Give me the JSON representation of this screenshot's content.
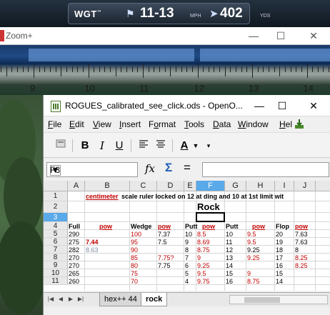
{
  "hud": {
    "logo": "WGT",
    "logo_mark": "™",
    "wind": "11-13",
    "wind_unit": "MPH",
    "distance": "402",
    "distance_unit": "YDS"
  },
  "zoom": {
    "title": "Zoom+",
    "minimize": "—",
    "maximize": "☐",
    "close": "✕",
    "ruler_numbers": [
      "9",
      "10",
      "11",
      "12",
      "13",
      "14"
    ]
  },
  "calc": {
    "title": "ROGUES_calibrated_see_click.ods - OpenO...",
    "minimize": "—",
    "maximize": "☐",
    "close": "✕",
    "menus": [
      {
        "label": "File",
        "u": "F",
        "rest": "ile"
      },
      {
        "label": "Edit",
        "u": "E",
        "rest": "dit"
      },
      {
        "label": "View",
        "u": "V",
        "rest": "iew"
      },
      {
        "label": "Insert",
        "u": "I",
        "rest": "nsert"
      },
      {
        "label": "Format",
        "u": "o",
        "pre": "F",
        "rest": "rmat"
      },
      {
        "label": "Tools",
        "u": "T",
        "rest": "ools"
      },
      {
        "label": "Data",
        "u": "D",
        "rest": "ata"
      },
      {
        "label": "Window",
        "u": "W",
        "rest": "indow"
      },
      {
        "label": "Help",
        "u": "H",
        "rest": "el"
      }
    ],
    "toolbar": {
      "bold": "B",
      "italic": "I",
      "underline": "U",
      "font_color": "A"
    },
    "namebox": "F3",
    "formula": "",
    "columns": [
      "A",
      "B",
      "C",
      "D",
      "E",
      "F",
      "G",
      "H",
      "I",
      "J"
    ],
    "rows": [
      "1",
      "2",
      "3",
      "4",
      "5",
      "6",
      "7",
      "8",
      "9",
      "10",
      "11"
    ],
    "row1_text": "centimeter",
    "row1_rest": " scale ruler locked on 12 at ding and 10 at 1st limit wit",
    "row2_text": "Rock",
    "headers": {
      "A": "Full",
      "B": "pow",
      "C": "Wedge",
      "D": "pow",
      "E": "Putt",
      "F": "pow",
      "G": "Putt",
      "H": "pow",
      "I": "Flop",
      "J": "pow"
    },
    "data": [
      {
        "A": "290",
        "B": "",
        "C": "100",
        "D": "7.37",
        "E": "10",
        "F": "8.5",
        "G": "10",
        "H": "9.5",
        "I": "20",
        "J": "7.63"
      },
      {
        "A": "275",
        "B": "7.44",
        "C": "95",
        "D": "7.5",
        "E": "9",
        "F": "8.69",
        "G": "11",
        "H": "9.5",
        "I": "19",
        "J": "7.63"
      },
      {
        "A": "282",
        "B": "8.63",
        "C": "90",
        "D": "",
        "E": "8",
        "F": "8.75",
        "G": "12",
        "H": "9.25",
        "I": "18",
        "J": "8"
      },
      {
        "A": "270",
        "B": "",
        "C": "85",
        "D": "7.75?",
        "E": "7",
        "F": "9",
        "G": "13",
        "H": "9.25",
        "I": "17",
        "J": "8.25"
      },
      {
        "A": "270",
        "B": "",
        "C": "80",
        "D": "7.75",
        "E": "6",
        "F": "9.25",
        "G": "14",
        "H": "",
        "I": "16",
        "J": "8.25"
      },
      {
        "A": "265",
        "B": "",
        "C": "75",
        "D": "",
        "E": "5",
        "F": "9.5",
        "G": "15",
        "H": "9",
        "I": "15",
        "J": ""
      },
      {
        "A": "260",
        "B": "",
        "C": "70",
        "D": "",
        "E": "4",
        "F": "9.75",
        "G": "16",
        "H": "8.75",
        "I": "14",
        "J": ""
      }
    ],
    "sheet_tabs": [
      "hex++ 44",
      "rock"
    ]
  }
}
